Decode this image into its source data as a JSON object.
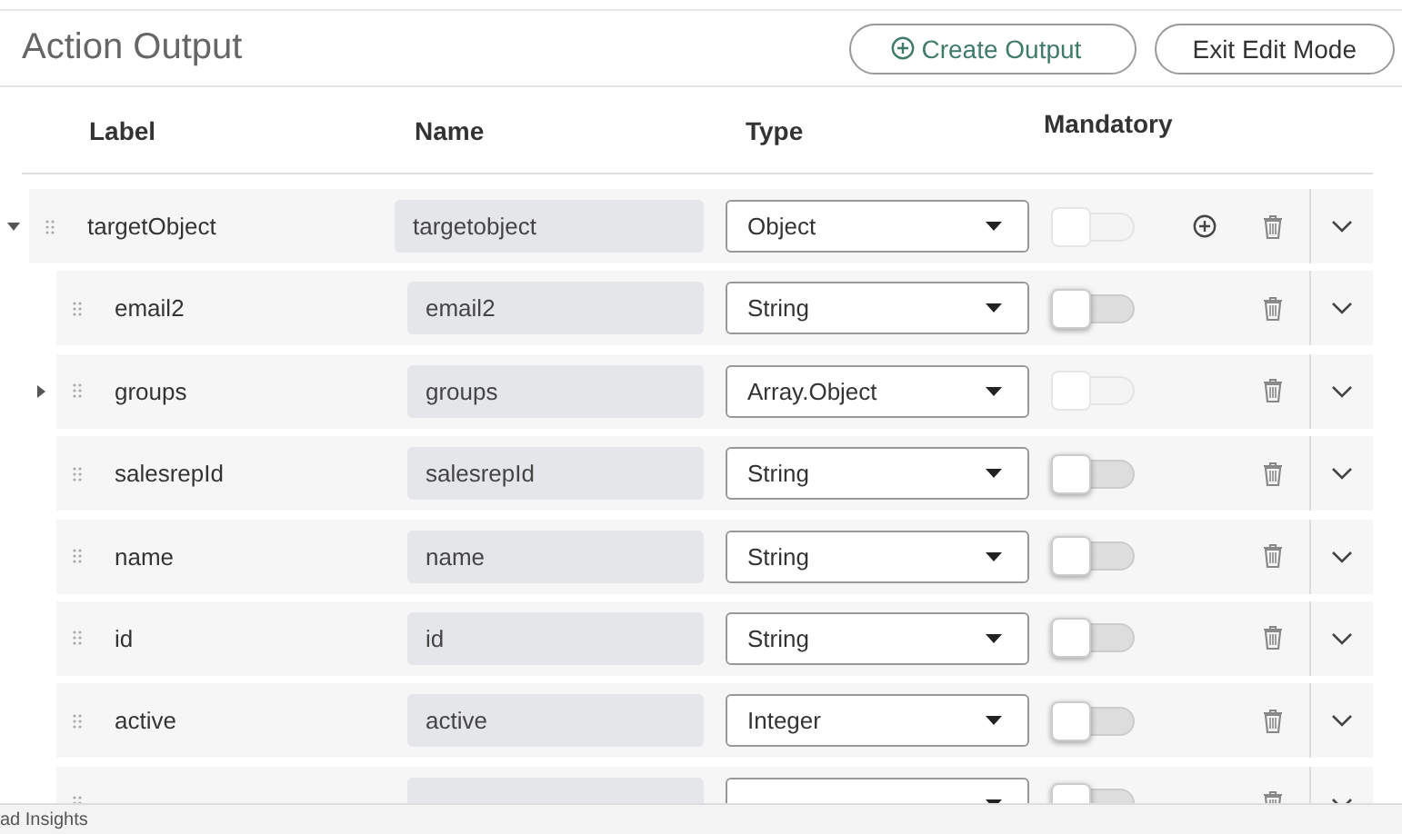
{
  "header": {
    "title": "Action Output",
    "buttons": [
      {
        "label": "Create Output",
        "kind": "add"
      },
      {
        "label": "Exit Edit Mode",
        "kind": "plain"
      }
    ]
  },
  "table": {
    "columns": [
      "Label",
      "Name",
      "Type",
      "Mandatory"
    ],
    "rows": [
      {
        "label": "targetObject",
        "name": "targetobject",
        "type": "Object",
        "mandatory": false,
        "toggle_disabled": true,
        "can_add": true,
        "expanded": true,
        "children": [
          {
            "label": "email2",
            "name": "email2",
            "type": "String",
            "mandatory": false,
            "toggle_disabled": false,
            "can_add": false
          },
          {
            "label": "groups",
            "name": "groups",
            "type": "Array.Object",
            "mandatory": false,
            "toggle_disabled": true,
            "can_add": false,
            "expanded": false
          },
          {
            "label": "salesrepId",
            "name": "salesrepId",
            "type": "String",
            "mandatory": false,
            "toggle_disabled": false,
            "can_add": false
          },
          {
            "label": "name",
            "name": "name",
            "type": "String",
            "mandatory": false,
            "toggle_disabled": false,
            "can_add": false
          },
          {
            "label": "id",
            "name": "id",
            "type": "String",
            "mandatory": false,
            "toggle_disabled": false,
            "can_add": false
          },
          {
            "label": "active",
            "name": "active",
            "type": "Integer",
            "mandatory": false,
            "toggle_disabled": false,
            "can_add": false
          },
          {
            "mandatory": false,
            "toggle_disabled": false,
            "can_add": false
          }
        ]
      }
    ]
  },
  "status_bar": {
    "text": "ad Insights"
  }
}
